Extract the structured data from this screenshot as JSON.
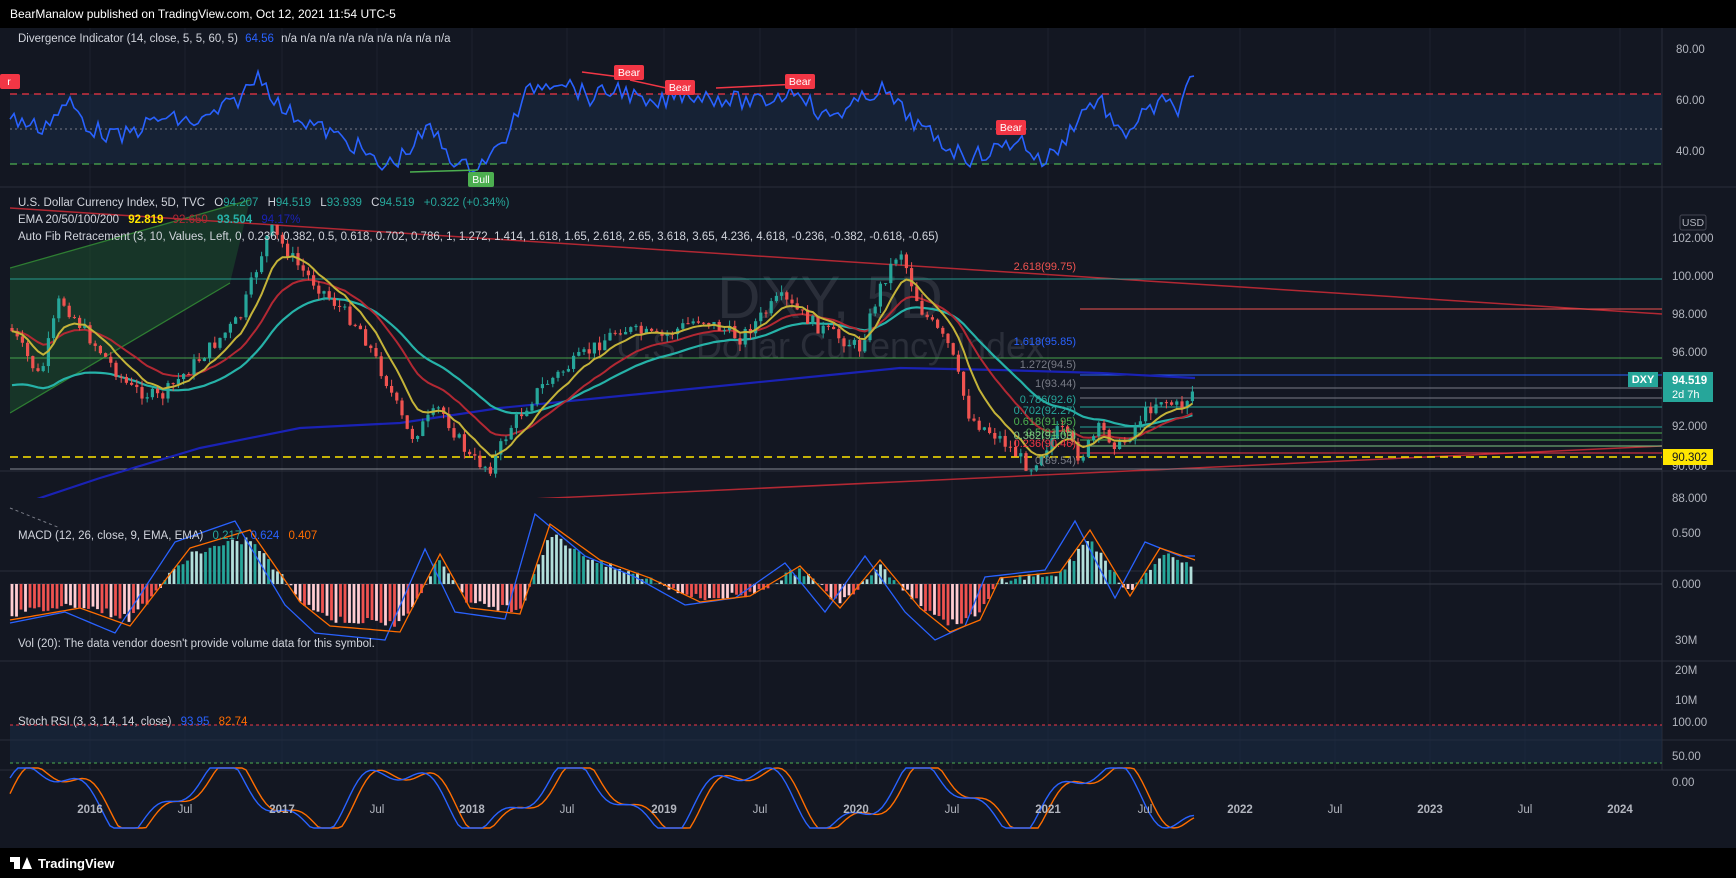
{
  "header": {
    "published": "BearManalow published on TradingView.com, Oct 12, 2021 11:54 UTC-5"
  },
  "footer": {
    "brand": "TradingView"
  },
  "panes": {
    "divergence": {
      "name": "Divergence Indicator (14, close, 5, 5, 60, 5)",
      "value": "64.56",
      "nas": "n/a  n/a  n/a  n/a  n/a  n/a  n/a  n/a  n/a",
      "ticks": [
        "80.00",
        "60.00",
        "40.00"
      ],
      "labels": {
        "bear1": "Bear",
        "bear2": "Bear",
        "bear3": "Bear",
        "bear4": "Bear",
        "bull": "Bull",
        "left_edge": "r"
      }
    },
    "main": {
      "symbol_line": {
        "name": "U.S. Dollar Currency Index, 5D, TVC",
        "o_label": "O",
        "o": "94.207",
        "h_label": "H",
        "h": "94.519",
        "l_label": "L",
        "l": "93.939",
        "c_label": "C",
        "c": "94.519",
        "change": "+0.322 (+0.34%)"
      },
      "ema_line": {
        "name": "EMA 20/50/100/200",
        "v1": "92.819",
        "v2": "92.650",
        "v3": "93.504",
        "v4": "94.17%"
      },
      "fib_line": "Auto Fib Retracement (3, 10, Values, Left, 0, 0.236, 0.382, 0.5, 0.618, 0.702, 0.786, 1, 1.272, 1.414, 1.618, 1.65, 2.618, 2.65, 3.618, 3.65, 4.236, 4.618, -0.236, -0.382, -0.618, -0.65)",
      "currency": "USD",
      "watermark_sym": "DXY, 5D",
      "watermark_name": "U.S. Dollar Currency Index",
      "ticks": [
        "102.000",
        "100.000",
        "98.000",
        "96.000",
        "92.000",
        "88.000"
      ],
      "partial_tick": "90.000",
      "price_badge": {
        "symbol": "DXY",
        "price": "94.519",
        "countdown": "2d 7h"
      },
      "line_badge": "90.302",
      "fib_labels": {
        "f2618": "2.618(99.75)",
        "f1618": "1.618(95.85)",
        "f1272": "1.272(94.5)",
        "f1": "1(93.44)",
        "f0786": "0.786(92.6)",
        "f0702": "0.702(92.27)",
        "f0618": "0.618(91.95)",
        "f05": "0.5(91.49)",
        "f0382": "0.382(91.03)",
        "f0236": "0.236(90.46)",
        "f0": "0(89.54)"
      }
    },
    "macd": {
      "name": "MACD (12, 26, close, 9, EMA, EMA)",
      "v1": "0.217",
      "v2": "0.624",
      "v3": "0.407",
      "ticks": [
        "0.500",
        "0.000"
      ]
    },
    "volume": {
      "text": "Vol (20): The data vendor doesn't provide volume data for this symbol.",
      "ticks": [
        "30M",
        "20M",
        "10M"
      ]
    },
    "stoch": {
      "name": "Stoch RSI (3, 3, 14, 14, close)",
      "v1": "93.95",
      "v2": "82.74",
      "ticks": [
        "100.00",
        "50.00",
        "0.00"
      ]
    }
  },
  "time_axis": [
    "2016",
    "Jul",
    "2017",
    "Jul",
    "2018",
    "Jul",
    "2019",
    "Jul",
    "2020",
    "Jul",
    "2021",
    "Jul",
    "2022",
    "Jul",
    "2023",
    "Jul",
    "2024"
  ],
  "colors": {
    "bg": "#131722",
    "up": "#26a69a",
    "down": "#ef5350",
    "rsi": "#2962ff",
    "bear": "#f23645",
    "bull": "#4caf50",
    "ema20": "#c4b339",
    "ema50": "#b22833",
    "ema100": "#26b2a8",
    "ema200": "#1a22b5"
  }
}
